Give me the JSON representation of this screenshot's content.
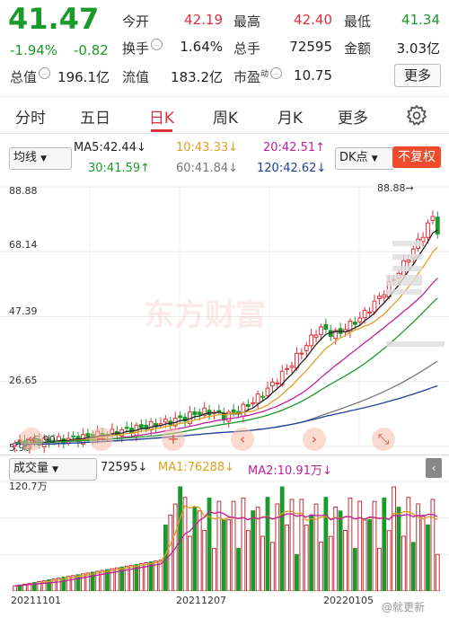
{
  "quote": {
    "price": "41.47",
    "change_pct": "-1.94%",
    "change": "-0.82",
    "open_label": "今开",
    "open": "42.19",
    "high_label": "最高",
    "high": "42.40",
    "low_label": "最低",
    "low": "41.34",
    "turnover_label": "换手",
    "turnover": "1.64%",
    "volume_label": "总手",
    "volume": "72595",
    "amount_label": "金额",
    "amount": "3.03亿",
    "mcap_label": "总值",
    "mcap": "196.1亿",
    "float_label": "流值",
    "float": "183.2亿",
    "pe_label": "市盈",
    "pe_sup": "动",
    "pe": "10.75",
    "more_label": "更多"
  },
  "tabs": {
    "items": [
      "分时",
      "五日",
      "日K",
      "周K",
      "月K",
      "更多"
    ],
    "active_index": 2,
    "settings_icon": "gear-icon"
  },
  "ma_bar": {
    "type_select": "均线",
    "ma5": "MA5:42.44↓",
    "ma10": "10:43.33↓",
    "ma20": "20:42.51↑",
    "ma30": "30:41.59↑",
    "ma60": "60:41.84↓",
    "ma120": "120:42.62↓",
    "dk_label": "DK点",
    "adjust_label": "不复权",
    "colors": {
      "ma5": "#222222",
      "ma10": "#e0a020",
      "ma20": "#c020a0",
      "ma30": "#1a9a2a",
      "ma60": "#777777",
      "ma120": "#2040a0"
    }
  },
  "price_axis": {
    "ticks": [
      "88.88",
      "68.14",
      "47.39",
      "26.65",
      "5.90"
    ],
    "max_marker": "88.88→",
    "min_marker": "←5.90"
  },
  "watermark": "东方财富",
  "volume_bar": {
    "select": "成交量",
    "volume": "72595↓",
    "ma1": "MA1:76288↓",
    "ma2": "MA2:10.91万↓",
    "axis_max": "120.7万"
  },
  "dates": [
    "20211101",
    "20211207",
    "20220105"
  ],
  "footer_watermark": "@就更新"
}
